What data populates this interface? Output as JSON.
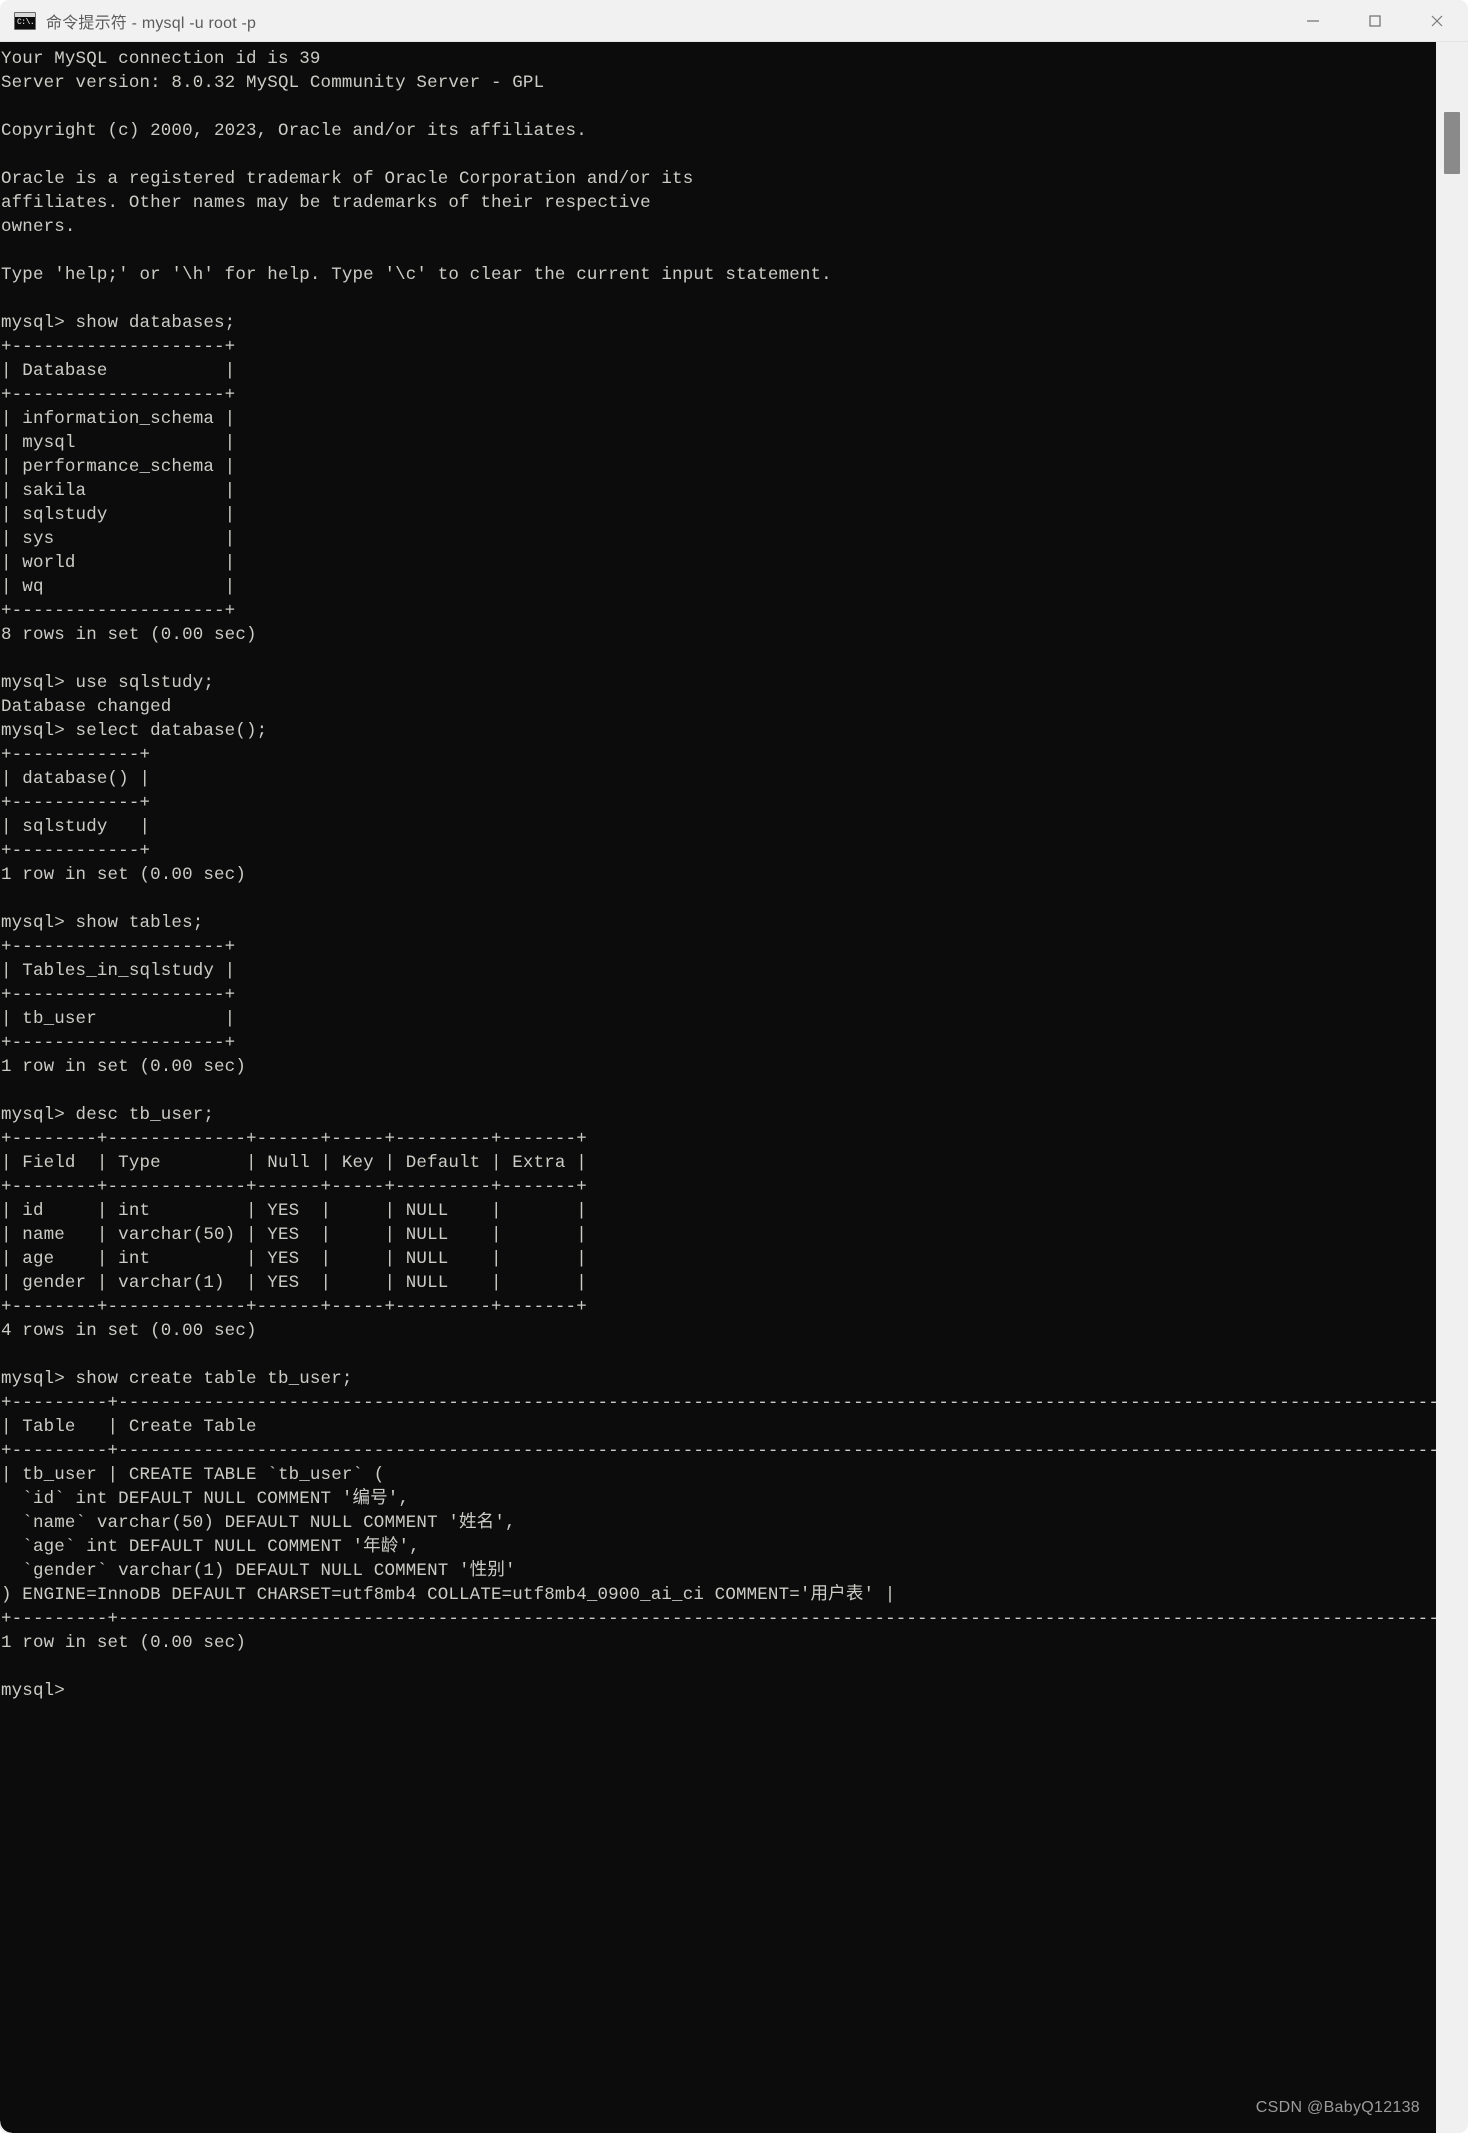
{
  "window": {
    "icon_name": "cmd-prompt-icon",
    "icon_glyph": "C:\\.",
    "title": "命令提示符 - mysql  -u root -p",
    "controls": {
      "minimize": "—",
      "maximize": "□",
      "close": "✕"
    }
  },
  "scrollbar": {
    "thumb_label": "vertical-scroll-thumb"
  },
  "watermark": "CSDN @BabyQ12138",
  "terminal": {
    "prompt": "mysql>",
    "banner": {
      "connection_id_line": "Your MySQL connection id is 39",
      "server_version_line": "Server version: 8.0.32 MySQL Community Server - GPL",
      "copyright_line": "Copyright (c) 2000, 2023, Oracle and/or its affiliates.",
      "trademark_lines": [
        "Oracle is a registered trademark of Oracle Corporation and/or its",
        "affiliates. Other names may be trademarks of their respective",
        "owners."
      ],
      "help_line": "Type 'help;' or '\\h' for help. Type '\\c' to clear the current input statement."
    },
    "commands": [
      "show databases;",
      "use sqlstudy;",
      "select database();",
      "show tables;",
      "desc tb_user;",
      "show create table tb_user;"
    ],
    "results": {
      "databases": {
        "header": "Database",
        "rows": [
          "information_schema",
          "mysql",
          "performance_schema",
          "sakila",
          "sqlstudy",
          "sys",
          "world",
          "wq"
        ],
        "footer": "8 rows in set (0.00 sec)"
      },
      "use_db": {
        "message": "Database changed"
      },
      "select_database": {
        "header": "database()",
        "rows": [
          "sqlstudy"
        ],
        "footer": "1 row in set (0.00 sec)"
      },
      "tables": {
        "header": "Tables_in_sqlstudy",
        "rows": [
          "tb_user"
        ],
        "footer": "1 row in set (0.00 sec)"
      },
      "desc_tb_user": {
        "columns": [
          "Field",
          "Type",
          "Null",
          "Key",
          "Default",
          "Extra"
        ],
        "rows": [
          [
            "id",
            "int",
            "YES",
            "",
            "NULL",
            ""
          ],
          [
            "name",
            "varchar(50)",
            "YES",
            "",
            "NULL",
            ""
          ],
          [
            "age",
            "int",
            "YES",
            "",
            "NULL",
            ""
          ],
          [
            "gender",
            "varchar(1)",
            "YES",
            "",
            "NULL",
            ""
          ]
        ],
        "footer": "4 rows in set (0.00 sec)"
      },
      "show_create_table": {
        "columns": [
          "Table",
          "Create Table"
        ],
        "table_name": "tb_user",
        "ddl_lines": [
          "CREATE TABLE `tb_user` (",
          "  `id` int DEFAULT NULL COMMENT '编号',",
          "  `name` varchar(50) DEFAULT NULL COMMENT '姓名',",
          "  `age` int DEFAULT NULL COMMENT '年龄',",
          "  `gender` varchar(1) DEFAULT NULL COMMENT '性别'",
          ") ENGINE=InnoDB DEFAULT CHARSET=utf8mb4 COLLATE=utf8mb4_0900_ai_ci COMMENT='用户表'"
        ],
        "footer": "1 row in set (0.00 sec)"
      }
    },
    "screen_text": "Your MySQL connection id is 39\nServer version: 8.0.32 MySQL Community Server - GPL\n\nCopyright (c) 2000, 2023, Oracle and/or its affiliates.\n\nOracle is a registered trademark of Oracle Corporation and/or its\naffiliates. Other names may be trademarks of their respective\nowners.\n\nType 'help;' or '\\h' for help. Type '\\c' to clear the current input statement.\n\nmysql> show databases;\n+--------------------+\n| Database           |\n+--------------------+\n| information_schema |\n| mysql              |\n| performance_schema |\n| sakila             |\n| sqlstudy           |\n| sys                |\n| world              |\n| wq                 |\n+--------------------+\n8 rows in set (0.00 sec)\n\nmysql> use sqlstudy;\nDatabase changed\nmysql> select database();\n+------------+\n| database() |\n+------------+\n| sqlstudy   |\n+------------+\n1 row in set (0.00 sec)\n\nmysql> show tables;\n+--------------------+\n| Tables_in_sqlstudy |\n+--------------------+\n| tb_user            |\n+--------------------+\n1 row in set (0.00 sec)\n\nmysql> desc tb_user;\n+--------+-------------+------+-----+---------+-------+\n| Field  | Type        | Null | Key | Default | Extra |\n+--------+-------------+------+-----+---------+-------+\n| id     | int         | YES  |     | NULL    |       |\n| name   | varchar(50) | YES  |     | NULL    |       |\n| age    | int         | YES  |     | NULL    |       |\n| gender | varchar(1)  | YES  |     | NULL    |       |\n+--------+-------------+------+-----+---------+-------+\n4 rows in set (0.00 sec)\n\nmysql> show create table tb_user;\n+---------+------------------------------------------------------------------------------------------------------------------------------------------------------------------------------------------------------------------------------------------------------------+\n| Table   | Create Table                                                                                                                                                                                                                                                |\n+---------+------------------------------------------------------------------------------------------------------------------------------------------------------------------------------------------------------------------------------------------------------------+\n| tb_user | CREATE TABLE `tb_user` (\n  `id` int DEFAULT NULL COMMENT '编号',\n  `name` varchar(50) DEFAULT NULL COMMENT '姓名',\n  `age` int DEFAULT NULL COMMENT '年龄',\n  `gender` varchar(1) DEFAULT NULL COMMENT '性别'\n) ENGINE=InnoDB DEFAULT CHARSET=utf8mb4 COLLATE=utf8mb4_0900_ai_ci COMMENT='用户表' |\n+---------+------------------------------------------------------------------------------------------------------------------------------------------------------------------------------------------------------------------------------------------------------------+\n1 row in set (0.00 sec)\n\nmysql>"
  }
}
